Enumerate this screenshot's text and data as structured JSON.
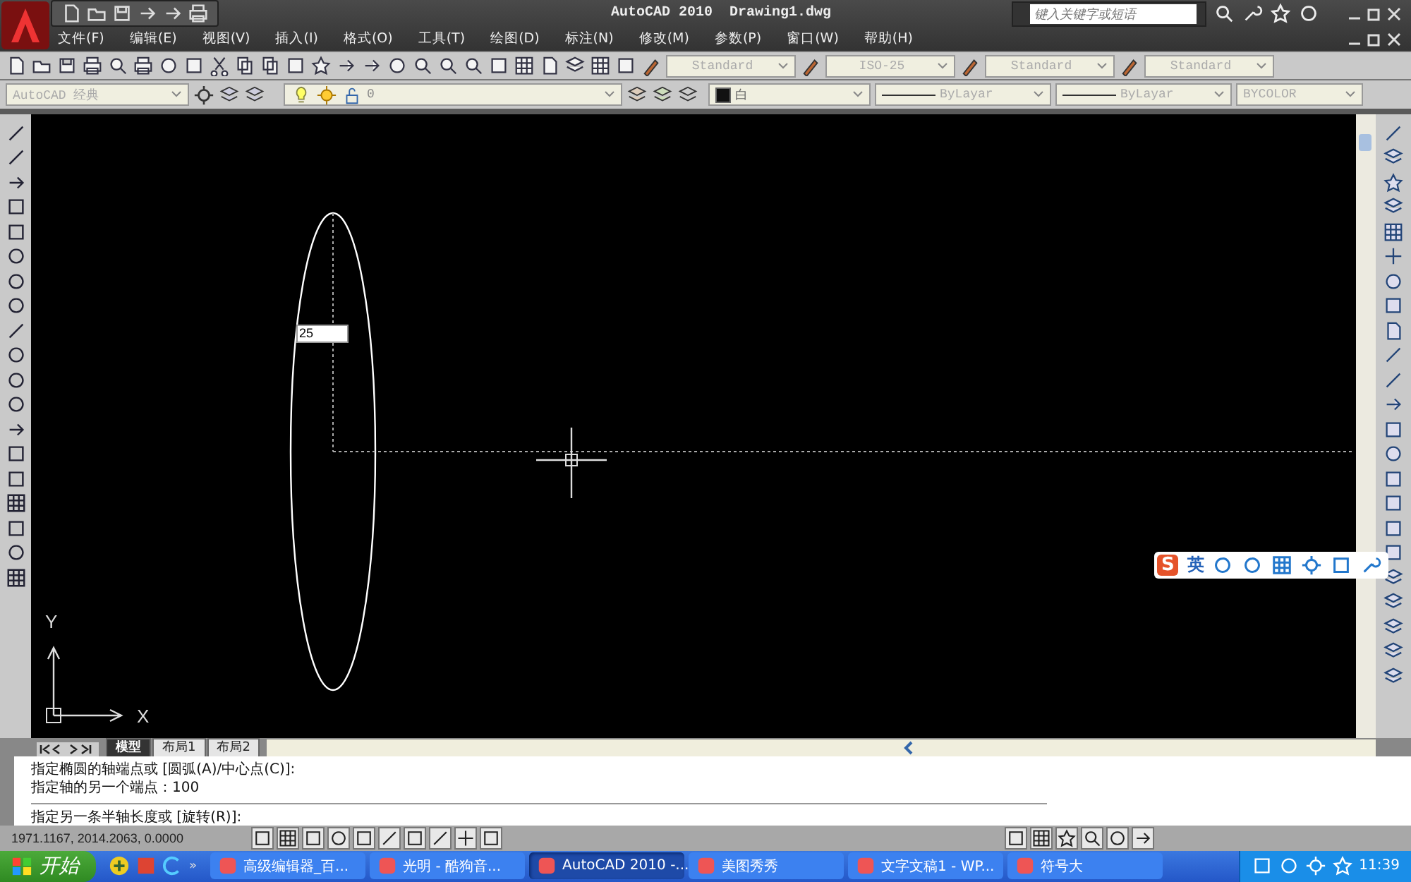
{
  "title_bar": {
    "title": "AutoCAD 2010  Drawing1.dwg",
    "search": {
      "placeholder": "键入关键字或短语"
    }
  },
  "menu": [
    "文件(F)",
    "编辑(E)",
    "视图(V)",
    "插入(I)",
    "格式(O)",
    "工具(T)",
    "绘图(D)",
    "标注(N)",
    "修改(M)",
    "参数(P)",
    "窗口(W)",
    "帮助(H)"
  ],
  "style_toolbar": [
    "Standard",
    "ISO-25",
    "Standard",
    "Standard"
  ],
  "workspace": "AutoCAD 经典",
  "layer": "0",
  "properties": {
    "color_name": "白",
    "linetype": "ByLayar",
    "lineweight": "ByLayar",
    "plotstyle": "BYCOLOR"
  },
  "canvas": {
    "dynamic_input": "25",
    "axis_x": "X",
    "axis_y": "Y"
  },
  "layout_tabs": [
    {
      "label": "模型",
      "selected": true
    },
    {
      "label": "布局1",
      "selected": false
    },
    {
      "label": "布局2",
      "selected": false
    }
  ],
  "command_history": [
    "指定椭圆的轴端点或 [圆弧(A)/中心点(C)]:",
    "指定轴的另一个端点：100"
  ],
  "command_prompt": "指定另一条半轴长度或 [旋转(R)]:",
  "status_bar": {
    "coordinates": "1971.1167, 2014.2063, 0.0000"
  },
  "ime_bar": {
    "logo": "S",
    "mode": "英"
  },
  "taskbar": {
    "start": "开始",
    "more": "»",
    "tasks": [
      {
        "label": "高级编辑器_百...",
        "selected": false
      },
      {
        "label": "光明 - 酷狗音...",
        "selected": false
      },
      {
        "label": "AutoCAD 2010 -...",
        "selected": true
      },
      {
        "label": "美图秀秀",
        "selected": false
      },
      {
        "label": "文字文稿1 - WP...",
        "selected": false
      },
      {
        "label": "符号大",
        "selected": false
      }
    ],
    "clock": "11:39"
  }
}
